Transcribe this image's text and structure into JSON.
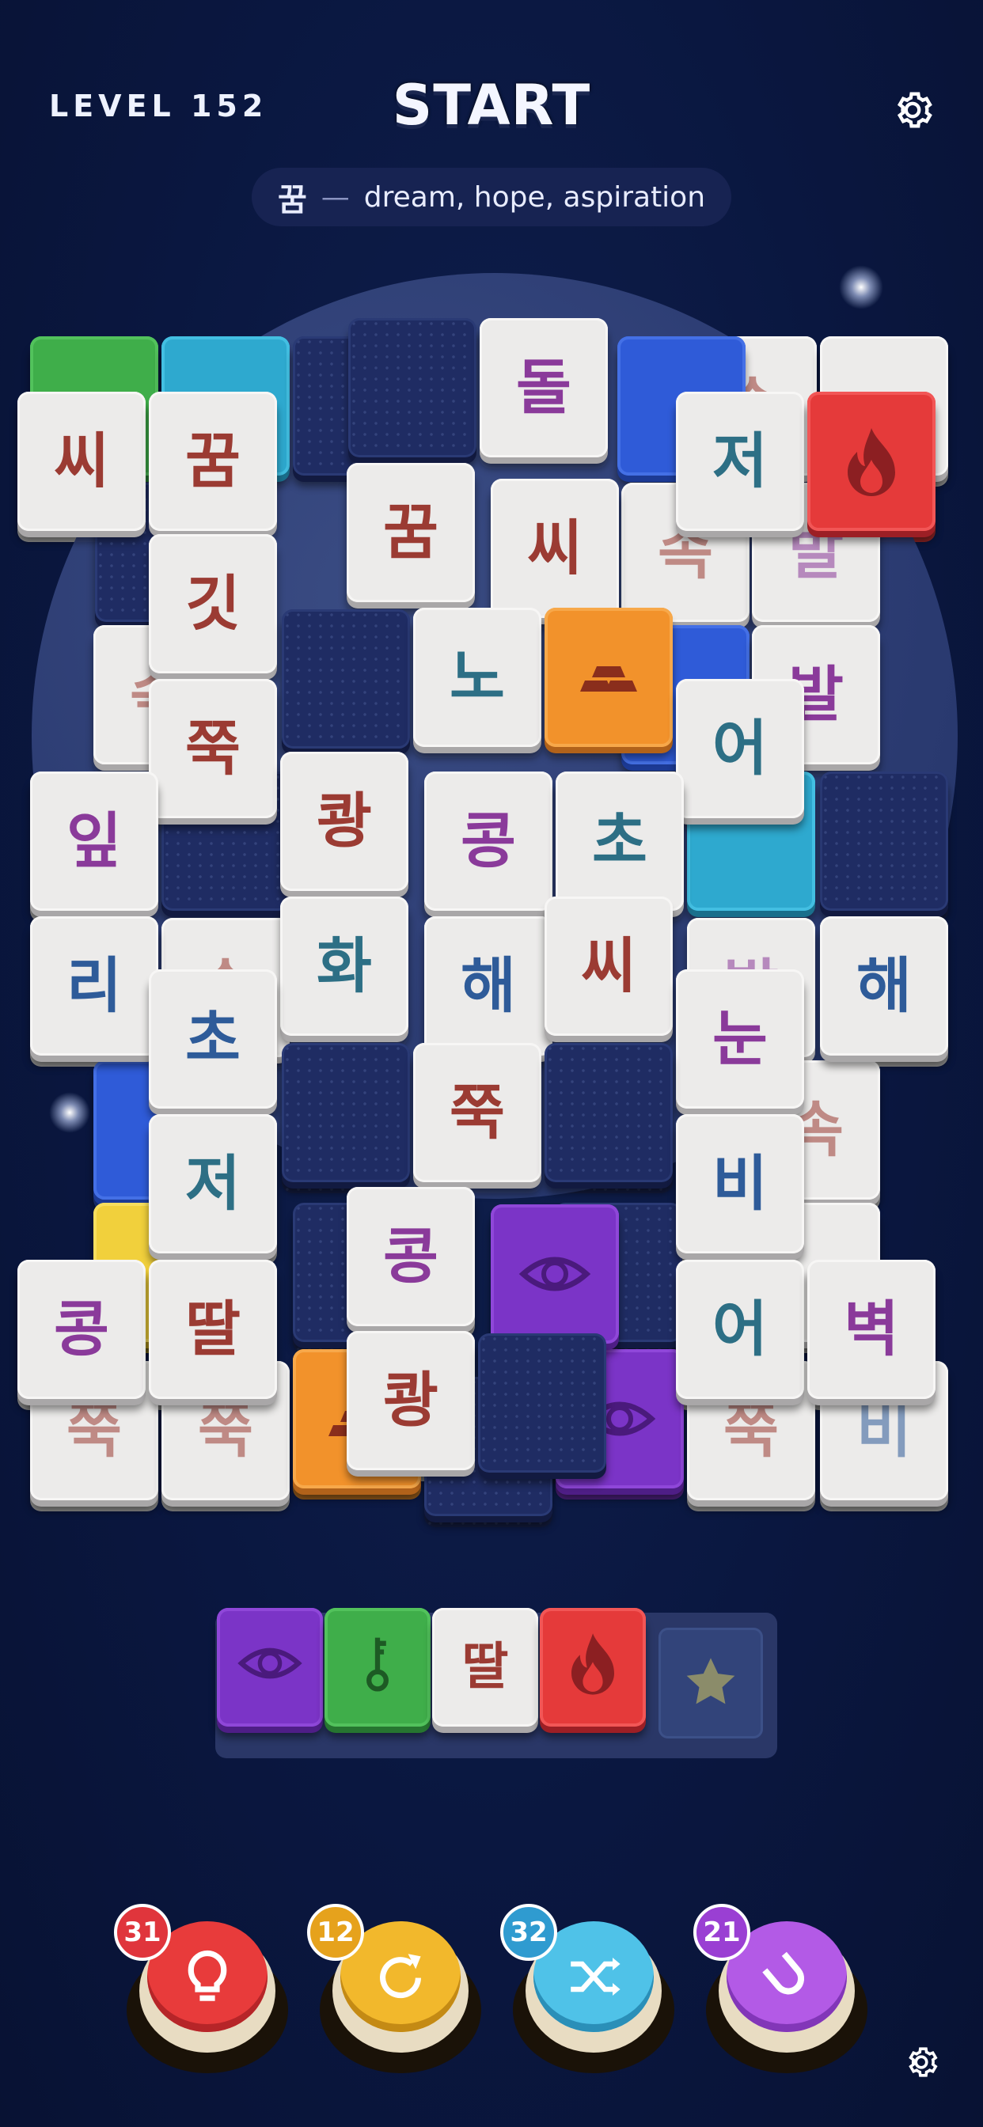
{
  "header": {
    "level": "LEVEL 152",
    "title": "START"
  },
  "hint": {
    "word": "꿈",
    "dash": "—",
    "meaning": "dream, hope, aspiration"
  },
  "board_tiles": {
    "t1": "씨",
    "t2": "꿈",
    "t3": "돌",
    "t4": "저",
    "t5": "꿈",
    "t6": "씨",
    "t7": "깃",
    "t8": "노",
    "t9": "쭉",
    "t10": "어",
    "t11": "잎",
    "t12": "쾅",
    "t13": "콩",
    "t14": "초",
    "t15": "리",
    "t16": "화",
    "t17": "해",
    "t18": "씨",
    "t19": "해",
    "t20": "초",
    "t21": "눈",
    "t22": "저",
    "t23": "쭉",
    "t24": "비",
    "t25": "콩",
    "t26": "콩",
    "t27": "딸",
    "t28": "어",
    "t29": "벽",
    "t30": "쾅",
    "p1": "쭉",
    "p2": "속",
    "p3": "발",
    "p4": "속",
    "p5": "쭉",
    "p6": "쭉",
    "p7": "쭉",
    "p8": "비",
    "p9": "발",
    "p10": "속"
  },
  "tray": {
    "slot3": "딸"
  },
  "boosters": {
    "hint_count": "31",
    "undo_count": "12",
    "shuffle_count": "32",
    "magnet_count": "21"
  },
  "colors": {
    "background": "#0a1740",
    "tile_face": "#ecebea",
    "red_tile": "#e53a3a",
    "orange_tile": "#f2922b",
    "purple_tile": "#7b34c7",
    "green_tile": "#3fae4a",
    "blue_tile": "#2f5bd8"
  },
  "icons": [
    "settings-gear-icon",
    "fire-icon",
    "gold-bars-icon",
    "eye-icon",
    "key-icon",
    "star-icon",
    "lightbulb-icon",
    "undo-icon",
    "shuffle-icon",
    "magnet-icon"
  ]
}
